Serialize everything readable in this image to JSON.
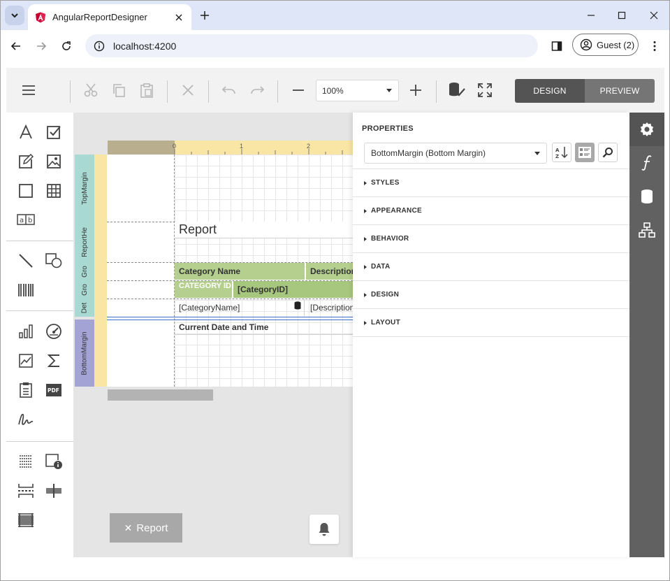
{
  "browser": {
    "tab_title": "AngularReportDesigner",
    "url": "localhost:4200",
    "profile_label": "Guest (2)"
  },
  "toolbar": {
    "zoom_value": "100%",
    "design_label": "DESIGN",
    "preview_label": "PREVIEW"
  },
  "surface": {
    "ruler_numbers": [
      "0",
      "1",
      "2"
    ],
    "bands": [
      {
        "name": "TopMargin",
        "color": "#a9d9d3"
      },
      {
        "name": "ReportHe",
        "color": "#a9d9d3"
      },
      {
        "name": "Gro",
        "color": "#a9d9d3"
      },
      {
        "name": "Gro",
        "color": "#a9d9d3"
      },
      {
        "name": "Det",
        "color": "#a9d9d3"
      },
      {
        "name": "BottomMargin",
        "color": "#a3a3d6"
      }
    ],
    "report_title": "Report",
    "header_category_name": "Category Name",
    "header_description": "Description",
    "group_category_id_label": "CATEGORY ID",
    "group_category_id_field": "[CategoryID]",
    "detail_category_name": "[CategoryName]",
    "detail_description": "[Description]",
    "footer_date": "Current Date and Time",
    "report_tab_label": "Report",
    "green_color": "#b5d08e",
    "green_dark": "#a7c77e"
  },
  "properties": {
    "title": "PROPERTIES",
    "selected_component": "BottomMargin (Bottom Margin)",
    "groups": [
      "STYLES",
      "APPEARANCE",
      "BEHAVIOR",
      "DATA",
      "DESIGN",
      "LAYOUT"
    ]
  },
  "right_tabs": [
    "gear-icon",
    "function-icon",
    "database-icon",
    "structure-icon"
  ]
}
